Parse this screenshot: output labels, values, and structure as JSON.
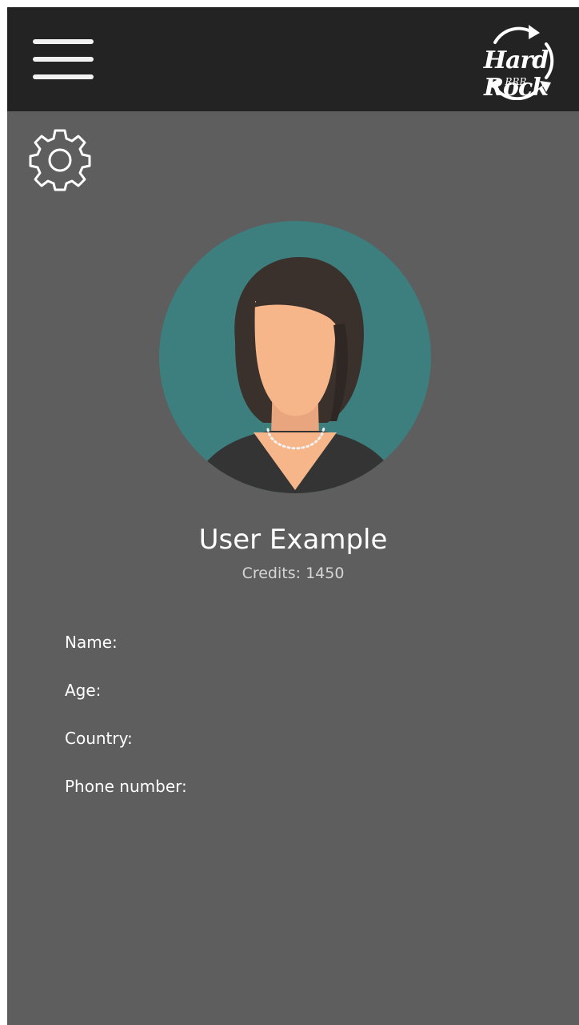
{
  "header": {
    "menu_icon": "hamburger-menu-icon",
    "logo": {
      "text": "Hard Rock",
      "sub": "RRR",
      "icon": "recycle-arrows-logo"
    }
  },
  "settings": {
    "icon": "gear-icon"
  },
  "profile": {
    "avatar_icon": "woman-avatar",
    "name": "User Example",
    "credits_label": "Credits:",
    "credits_value": "1450"
  },
  "fields": [
    {
      "label": "Name:"
    },
    {
      "label": "Age:"
    },
    {
      "label": "Country:"
    },
    {
      "label": "Phone number:"
    }
  ],
  "colors": {
    "topbar": "#232323",
    "background": "#5e5e5e",
    "avatar_bg": "#3d7f7f",
    "text": "#ffffff"
  }
}
